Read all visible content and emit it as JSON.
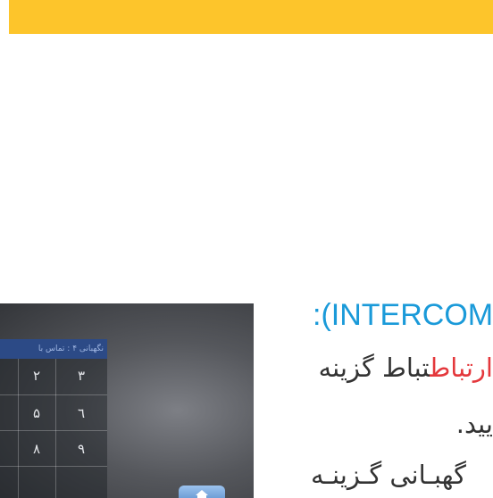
{
  "header": {
    "bar_color": "#fdc52b"
  },
  "section": {
    "heading": ":(INTERCOM",
    "line1_text": "تباط گزینه",
    "line1_highlight": "ارتباط",
    "line2": "یید.",
    "line3": "گهبـانی گـزینـه"
  },
  "device": {
    "keypad_title": "نگهبانی ۴ : تماس با",
    "keys": [
      "۲",
      "۳",
      "۵",
      "٦",
      "۸",
      "۹"
    ],
    "home_icon": "home-icon"
  },
  "colors": {
    "heading": "#1a9ad9",
    "highlight": "#e4383c",
    "body_text": "#333333"
  }
}
